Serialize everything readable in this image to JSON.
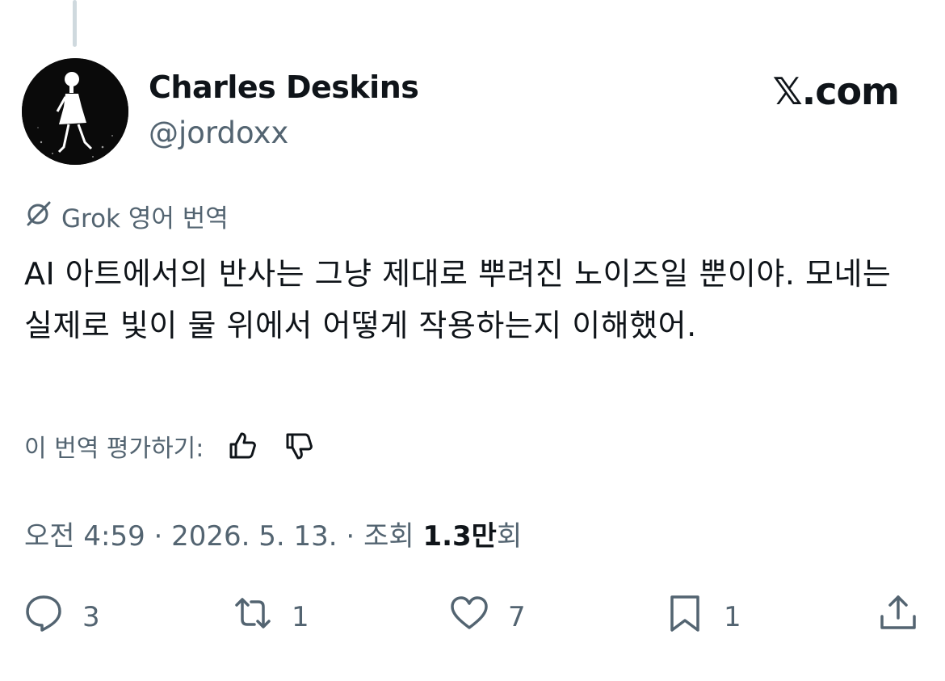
{
  "author": {
    "display_name": "Charles Deskins",
    "handle": "@jordoxx"
  },
  "brand": "𝕏.com",
  "translation": {
    "label": "Grok 영어 번역",
    "icon": "grok-icon"
  },
  "tweet": {
    "text": "AI 아트에서의 반사는 그냥 제대로 뿌려진 노이즈일 뿐이야. 모네는 실제로 빛이 물 위에서 어떻게 작용하는지 이해했어."
  },
  "rating": {
    "label": "이 번역 평가하기:",
    "up_icon": "thumbs-up-icon",
    "down_icon": "thumbs-down-icon"
  },
  "meta": {
    "time": "오전 4:59",
    "sep1": " · ",
    "date": "2026. 5. 13.",
    "sep2": " · ",
    "views_label": "조회 ",
    "views_count": "1.3만",
    "views_suffix": "회"
  },
  "actions": {
    "replies": "3",
    "reposts": "1",
    "likes": "7",
    "bookmarks": "1"
  },
  "colors": {
    "text": "#0f1419",
    "secondary": "#536471",
    "thread_line": "#cfd9de"
  }
}
